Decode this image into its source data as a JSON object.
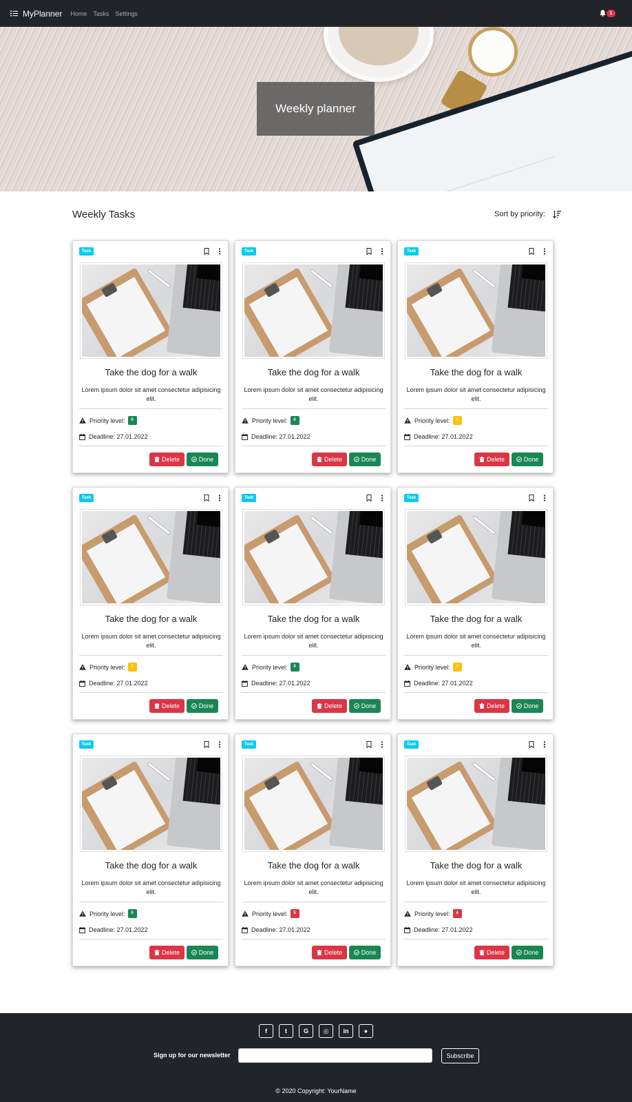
{
  "navbar": {
    "brand": "MyPlanner",
    "links": [
      "Home",
      "Tasks",
      "Settings"
    ],
    "notification_count": "1"
  },
  "hero": {
    "title": "Weekly planner"
  },
  "main": {
    "title": "Weekly Tasks",
    "sort_label": "Sort by priority:"
  },
  "cards": [
    {
      "tag": "Task",
      "title": "Take the dog for a walk",
      "text": "Lorem ipsum dolor sit amet consectetur adipisicing elit.",
      "priority_label": "Priority level:",
      "priority": "0",
      "priority_color": "#198754",
      "deadline": "Deadline: 27.01.2022",
      "delete_label": "Delete",
      "done_label": "Done"
    },
    {
      "tag": "Task",
      "title": "Take the dog for a walk",
      "text": "Lorem ipsum dolor sit amet consectetur adipisicing elit.",
      "priority_label": "Priority level:",
      "priority": "0",
      "priority_color": "#198754",
      "deadline": "Deadline: 27.01.2022",
      "delete_label": "Delete",
      "done_label": "Done"
    },
    {
      "tag": "Task",
      "title": "Take the dog for a walk",
      "text": "Lorem ipsum dolor sit amet consectetur adipisicing elit.",
      "priority_label": "Priority level:",
      "priority": "3",
      "priority_color": "#ffc107",
      "deadline": "Deadline: 27.01.2022",
      "delete_label": "Delete",
      "done_label": "Done"
    },
    {
      "tag": "Task",
      "title": "Take the dog for a walk",
      "text": "Lorem ipsum dolor sit amet consectetur adipisicing elit.",
      "priority_label": "Priority level:",
      "priority": "2",
      "priority_color": "#ffc107",
      "deadline": "Deadline: 27.01.2022",
      "delete_label": "Delete",
      "done_label": "Done"
    },
    {
      "tag": "Task",
      "title": "Take the dog for a walk",
      "text": "Lorem ipsum dolor sit amet consectetur adipisicing elit.",
      "priority_label": "Priority level:",
      "priority": "0",
      "priority_color": "#198754",
      "deadline": "Deadline: 27.01.2022",
      "delete_label": "Delete",
      "done_label": "Done"
    },
    {
      "tag": "Task",
      "title": "Take the dog for a walk",
      "text": "Lorem ipsum dolor sit amet consectetur adipisicing elit.",
      "priority_label": "Priority level:",
      "priority": "3",
      "priority_color": "#ffc107",
      "deadline": "Deadline: 27.01.2022",
      "delete_label": "Delete",
      "done_label": "Done"
    },
    {
      "tag": "Task",
      "title": "Take the dog for a walk",
      "text": "Lorem ipsum dolor sit amet consectetur adipisicing elit.",
      "priority_label": "Priority level:",
      "priority": "0",
      "priority_color": "#198754",
      "deadline": "Deadline: 27.01.2022",
      "delete_label": "Delete",
      "done_label": "Done"
    },
    {
      "tag": "Task",
      "title": "Take the dog for a walk",
      "text": "Lorem ipsum dolor sit amet consectetur adipisicing elit.",
      "priority_label": "Priority level:",
      "priority": "5",
      "priority_color": "#dc3545",
      "deadline": "Deadline: 27.01.2022",
      "delete_label": "Delete",
      "done_label": "Done"
    },
    {
      "tag": "Task",
      "title": "Take the dog for a walk",
      "text": "Lorem ipsum dolor sit amet consectetur adipisicing elit.",
      "priority_label": "Priority level:",
      "priority": "4",
      "priority_color": "#dc3545",
      "deadline": "Deadline: 27.01.2022",
      "delete_label": "Delete",
      "done_label": "Done"
    }
  ],
  "footer": {
    "social": [
      {
        "icon": "facebook-icon",
        "glyph": "f"
      },
      {
        "icon": "twitter-icon",
        "glyph": "t"
      },
      {
        "icon": "google-icon",
        "glyph": "G"
      },
      {
        "icon": "instagram-icon",
        "glyph": "◎"
      },
      {
        "icon": "linkedin-icon",
        "glyph": "in"
      },
      {
        "icon": "github-icon",
        "glyph": "●"
      }
    ],
    "newsletter_label": "Sign up for our newsletter",
    "newsletter_value": "",
    "subscribe_label": "Subscribe",
    "copyright": "© 2020 Copyright: YourName"
  }
}
